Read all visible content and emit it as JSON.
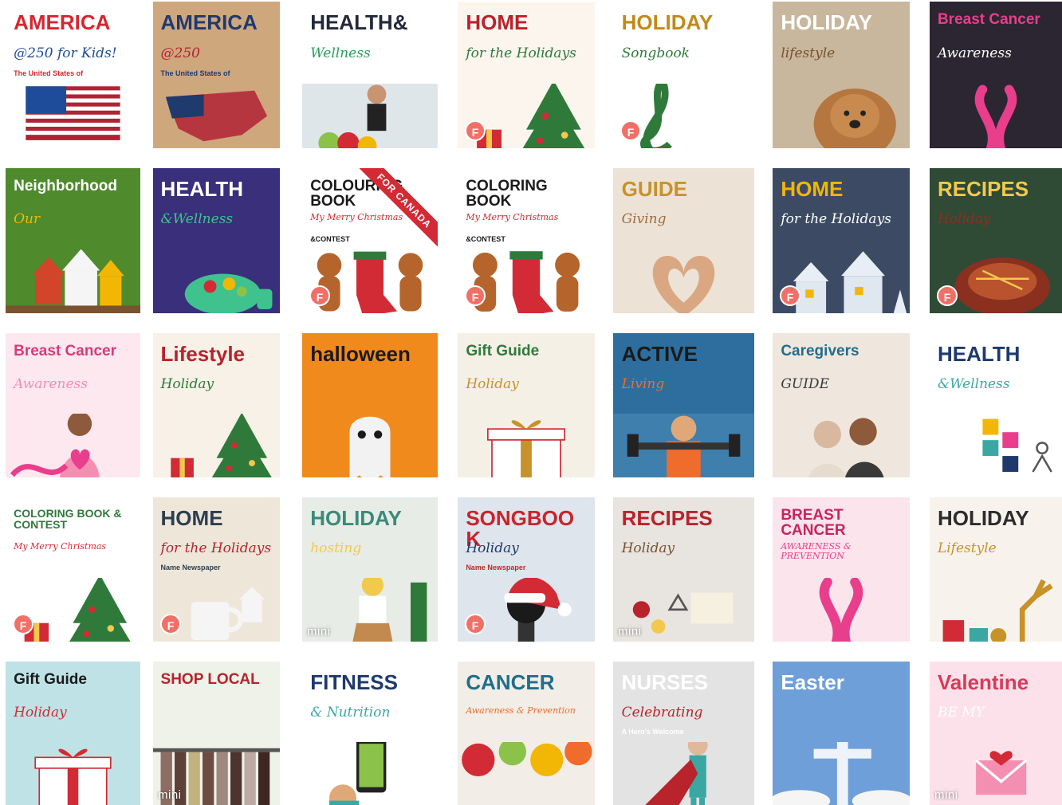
{
  "gallery": {
    "tiles": [
      {
        "id": "america250-kids",
        "title": "AMERICA",
        "subtitle": "@250 for Kids!",
        "kicker": "The United States of",
        "bg": "#ffffff",
        "fg": "#d62631",
        "accent": "#1e4c9a",
        "art": "flag-usa-icon",
        "badge": ""
      },
      {
        "id": "america250",
        "title": "AMERICA",
        "subtitle": "@250",
        "kicker": "The United States of",
        "bg": "#cfa77d",
        "fg": "#1f3a6d",
        "accent": "#b22234",
        "art": "usa-map-icon",
        "badge": ""
      },
      {
        "id": "health-wellness-1",
        "title": "HEALTH&",
        "subtitle": "Wellness",
        "kicker": "",
        "bg": "#ffffff",
        "fg": "#222a3a",
        "accent": "#23a05a",
        "art": "fitness-photo-icon",
        "badge": ""
      },
      {
        "id": "home-holidays-1",
        "title": "HOME",
        "subtitle": "for the Holidays",
        "kicker": "",
        "bg": "#fbf5ee",
        "fg": "#b8232c",
        "accent": "#2f7a3b",
        "art": "christmas-tree-icon",
        "badge": "F"
      },
      {
        "id": "holiday-songbook-1",
        "title": "HOLIDAY",
        "subtitle": "Songbook",
        "kicker": "",
        "bg": "#ffffff",
        "fg": "#c28a18",
        "accent": "#2f7a3b",
        "art": "treble-clef-icon",
        "badge": "F"
      },
      {
        "id": "holiday-lifestyle-1",
        "title": "HOLIDAY",
        "subtitle": "lifestyle",
        "kicker": "",
        "bg": "#c8b79c",
        "fg": "#ffffff",
        "accent": "#7a5230",
        "art": "dog-photo-icon",
        "badge": ""
      },
      {
        "id": "breast-cancer-1",
        "title": "Breast Cancer",
        "subtitle": "Awareness",
        "kicker": "",
        "bg": "#2b2631",
        "fg": "#e83e8c",
        "accent": "#ffffff",
        "art": "pink-ribbon-icon",
        "badge": ""
      },
      {
        "id": "our-neighborhood",
        "title": "Neighborhood",
        "subtitle": "Our",
        "kicker": "",
        "bg": "#4f8a2c",
        "fg": "#ffffff",
        "accent": "#f2b705",
        "art": "houses-icon",
        "badge": ""
      },
      {
        "id": "health-wellness-2",
        "title": "HEALTH",
        "subtitle": "&Wellness",
        "kicker": "",
        "bg": "#3a2f7a",
        "fg": "#ffffff",
        "accent": "#3fc28e",
        "art": "salad-bowl-icon",
        "badge": ""
      },
      {
        "id": "colouring-canada",
        "title": "COLOURING BOOK",
        "subtitle": "My Merry Christmas",
        "kicker": "&CONTEST",
        "bg": "#ffffff",
        "fg": "#1a1a1a",
        "accent": "#d22b35",
        "art": "gingerbread-icon",
        "badge": "F",
        "ribbon": "FOR CANADA"
      },
      {
        "id": "colouring-book",
        "title": "COLORING BOOK",
        "subtitle": "My Merry Christmas",
        "kicker": "&CONTEST",
        "bg": "#ffffff",
        "fg": "#1a1a1a",
        "accent": "#d22b35",
        "art": "gingerbread-icon",
        "badge": "F"
      },
      {
        "id": "giving-guide",
        "title": "GUIDE",
        "subtitle": "Giving",
        "kicker": "",
        "bg": "#ece3d6",
        "fg": "#c8922a",
        "accent": "#9e6b3e",
        "art": "heart-hands-icon",
        "badge": ""
      },
      {
        "id": "home-holidays-2",
        "title": "HOME",
        "subtitle": "for the Holidays",
        "kicker": "",
        "bg": "#3c4b63",
        "fg": "#f2b705",
        "accent": "#ffffff",
        "art": "winter-houses-icon",
        "badge": "F"
      },
      {
        "id": "holiday-recipes-1",
        "title": "RECIPES",
        "subtitle": "Holiday",
        "kicker": "",
        "bg": "#2f4b36",
        "fg": "#f2c94c",
        "accent": "#8b2f1f",
        "art": "roast-ham-icon",
        "badge": "F"
      },
      {
        "id": "breast-cancer-2",
        "title": "Breast Cancer",
        "subtitle": "Awareness",
        "kicker": "",
        "bg": "#fde8ef",
        "fg": "#d63b7a",
        "accent": "#f48fb1",
        "art": "woman-heart-icon",
        "badge": ""
      },
      {
        "id": "holiday-lifestyle-2",
        "title": "Lifestyle",
        "subtitle": "Holiday",
        "kicker": "",
        "bg": "#f7f1e8",
        "fg": "#b8232c",
        "accent": "#2f7a3b",
        "art": "christmas-tree-icon",
        "badge": ""
      },
      {
        "id": "halloween",
        "title": "halloween",
        "subtitle": "",
        "kicker": "",
        "bg": "#f08a1c",
        "fg": "#1a1a1a",
        "accent": "#ffffff",
        "art": "ghost-icon",
        "badge": ""
      },
      {
        "id": "holiday-gift-guide-1",
        "title": "Gift Guide",
        "subtitle": "Holiday",
        "kicker": "",
        "bg": "#f5f0e6",
        "fg": "#2f7a3b",
        "accent": "#c8922a",
        "art": "gift-box-icon",
        "badge": ""
      },
      {
        "id": "active-living",
        "title": "ACTIVE",
        "subtitle": "Living",
        "kicker": "",
        "bg": "#2d6e9e",
        "fg": "#1a1a1a",
        "accent": "#ef6c2d",
        "art": "dumbbell-icon",
        "badge": ""
      },
      {
        "id": "caregivers-guide",
        "title": "Caregivers",
        "subtitle": "GUIDE",
        "kicker": "",
        "bg": "#efe7dd",
        "fg": "#1f6e8c",
        "accent": "#3a3a3a",
        "art": "caregivers-photo-icon",
        "badge": ""
      },
      {
        "id": "health-wellness-3",
        "title": "HEALTH",
        "subtitle": "&Wellness",
        "kicker": "",
        "bg": "#ffffff",
        "fg": "#1e3a6d",
        "accent": "#3aa7a3",
        "art": "yoga-figure-icon",
        "badge": ""
      },
      {
        "id": "coloring-contest",
        "title": "COLORING BOOK & CONTEST",
        "subtitle": "My Merry Christmas",
        "kicker": "",
        "bg": "#ffffff",
        "fg": "#2f7a3b",
        "accent": "#d22b35",
        "art": "christmas-tree-icon",
        "badge": "F"
      },
      {
        "id": "home-holidays-3",
        "title": "HOME",
        "subtitle": "for the Holidays",
        "kicker": "Name Newspaper",
        "bg": "#efe6da",
        "fg": "#2c3e50",
        "accent": "#b8232c",
        "art": "mug-icon",
        "badge": "F"
      },
      {
        "id": "holiday-hosting",
        "title": "HOLIDAY",
        "subtitle": "hosting",
        "kicker": "",
        "bg": "#e7ece6",
        "fg": "#3a8a7a",
        "accent": "#f2c94c",
        "art": "host-photo-icon",
        "badge": "",
        "mini": "mini"
      },
      {
        "id": "holiday-songbook-2",
        "title": "SONGBOOK",
        "subtitle": "Holiday",
        "kicker": "Name Newspaper",
        "bg": "#dfe5ec",
        "fg": "#c8242c",
        "accent": "#1e3a6d",
        "art": "microphone-santa-hat-icon",
        "badge": "F"
      },
      {
        "id": "holiday-recipes-2",
        "title": "RECIPES",
        "subtitle": "Holiday",
        "kicker": "",
        "bg": "#e8e4e0",
        "fg": "#b8232c",
        "accent": "#7a5230",
        "art": "baking-icon",
        "badge": "",
        "mini": "mini"
      },
      {
        "id": "breast-cancer-3",
        "title": "BREAST CANCER",
        "subtitle": "AWARENESS & PREVENTION",
        "kicker": "",
        "bg": "#fbe4ec",
        "fg": "#c8245c",
        "accent": "#e83e8c",
        "art": "pink-ribbon-icon",
        "badge": ""
      },
      {
        "id": "holiday-lifestyle-3",
        "title": "HOLIDAY",
        "subtitle": "Lifestyle",
        "kicker": "",
        "bg": "#f7f3ec",
        "fg": "#2c2c2c",
        "accent": "#c8922a",
        "art": "reindeer-icon",
        "badge": ""
      },
      {
        "id": "holiday-gift-guide-2",
        "title": "Gift Guide",
        "subtitle": "Holiday",
        "kicker": "",
        "bg": "#bfe2e6",
        "fg": "#1a1a1a",
        "accent": "#d22b35",
        "art": "gift-box-icon",
        "badge": ""
      },
      {
        "id": "shop-local",
        "title": "SHOP LOCAL",
        "subtitle": "",
        "kicker": "",
        "bg": "#eef2e8",
        "fg": "#b8232c",
        "accent": "#8bc34a",
        "art": "clothes-rack-icon",
        "badge": "",
        "mini": "mini"
      },
      {
        "id": "fitness-nutrition",
        "title": "FITNESS",
        "subtitle": "& Nutrition",
        "kicker": "",
        "bg": "#ffffff",
        "fg": "#1e3a6d",
        "accent": "#3aa7a3",
        "art": "phone-workout-icon",
        "badge": ""
      },
      {
        "id": "cancer-awareness",
        "title": "CANCER",
        "subtitle": "Awareness & Prevention",
        "kicker": "",
        "bg": "#f2ede6",
        "fg": "#1f6e8c",
        "accent": "#ef6c2d",
        "art": "vegetables-icon",
        "badge": ""
      },
      {
        "id": "celebrating-nurses",
        "title": "NURSES",
        "subtitle": "Celebrating",
        "kicker": "A Hero's Welcome",
        "bg": "#e3e3e3",
        "fg": "#ffffff",
        "accent": "#b8232c",
        "art": "nurse-hero-icon",
        "badge": ""
      },
      {
        "id": "easter",
        "title": "Easter",
        "subtitle": "",
        "kicker": "",
        "bg": "#6f9fd8",
        "fg": "#ffffff",
        "accent": "#f2f2f2",
        "art": "cross-icon",
        "badge": ""
      },
      {
        "id": "be-my-valentine",
        "title": "Valentine",
        "subtitle": "BE MY",
        "kicker": "",
        "bg": "#fde1ea",
        "fg": "#d63b5a",
        "accent": "#ffffff",
        "art": "envelope-hearts-icon",
        "badge": "",
        "mini": "mini"
      }
    ]
  }
}
